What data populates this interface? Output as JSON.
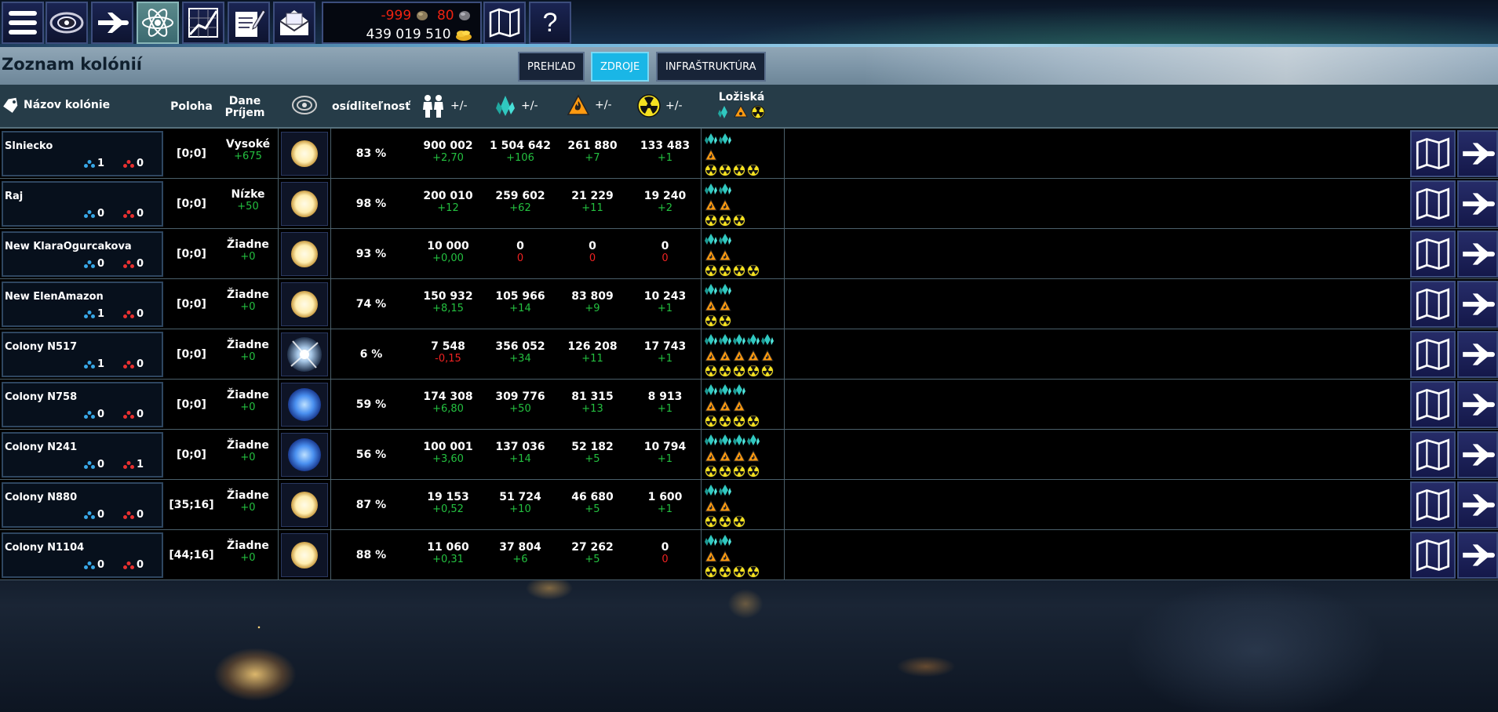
{
  "toolbar": {
    "icons": [
      "menu-icon",
      "galaxy-icon",
      "fleet-icon",
      "research-icon",
      "stats-icon",
      "notes-icon",
      "mail-icon",
      "map-icon",
      "help-icon"
    ],
    "help_label": "?"
  },
  "resources": {
    "stone": "-999",
    "ore": "80",
    "gold": "439 019 510"
  },
  "page": {
    "title": "Zoznam kolónií"
  },
  "tabs": [
    {
      "label": "PREHĽAD",
      "active": false
    },
    {
      "label": "ZDROJE",
      "active": true
    },
    {
      "label": "INFRAŠTRUKTÚRA",
      "active": false
    }
  ],
  "header": {
    "name": "Názov kolónie",
    "position": "Poloha",
    "tax_line1": "Dane",
    "tax_line2": "Príjem",
    "habitability": "osídliteľnosť",
    "pm": "+/-",
    "deposits": "Ložiská"
  },
  "colonies": [
    {
      "name": "Slniecko",
      "blue": "1",
      "red": "0",
      "pos": "[0;0]",
      "tax": "Vysoké",
      "income": "+675",
      "star": "yellow",
      "hab": "83 %",
      "pop": "900 002",
      "pop_d": "+2,70",
      "pop_neg": false,
      "cry": "1 504 642",
      "cry_d": "+106",
      "cry_neg": false,
      "fuel": "261 880",
      "fuel_d": "+7",
      "fuel_neg": false,
      "rad": "133 483",
      "rad_d": "+1",
      "rad_neg": false,
      "dep": [
        2,
        1,
        4
      ]
    },
    {
      "name": "Raj",
      "blue": "0",
      "red": "0",
      "pos": "[0;0]",
      "tax": "Nízke",
      "income": "+50",
      "star": "yellow",
      "hab": "98 %",
      "pop": "200 010",
      "pop_d": "+12",
      "pop_neg": false,
      "cry": "259 602",
      "cry_d": "+62",
      "cry_neg": false,
      "fuel": "21 229",
      "fuel_d": "+11",
      "fuel_neg": false,
      "rad": "19 240",
      "rad_d": "+2",
      "rad_neg": false,
      "dep": [
        2,
        2,
        3
      ]
    },
    {
      "name": "New KlaraOgurcakova",
      "blue": "0",
      "red": "0",
      "pos": "[0;0]",
      "tax": "Žiadne",
      "income": "+0",
      "star": "yellow",
      "hab": "93 %",
      "pop": "10 000",
      "pop_d": "+0,00",
      "pop_neg": false,
      "cry": "0",
      "cry_d": "0",
      "cry_neg": true,
      "fuel": "0",
      "fuel_d": "0",
      "fuel_neg": true,
      "rad": "0",
      "rad_d": "0",
      "rad_neg": true,
      "dep": [
        2,
        2,
        4
      ]
    },
    {
      "name": "New ElenAmazon",
      "blue": "1",
      "red": "0",
      "pos": "[0;0]",
      "tax": "Žiadne",
      "income": "+0",
      "star": "yellow",
      "hab": "74 %",
      "pop": "150 932",
      "pop_d": "+8,15",
      "pop_neg": false,
      "cry": "105 966",
      "cry_d": "+14",
      "cry_neg": false,
      "fuel": "83 809",
      "fuel_d": "+9",
      "fuel_neg": false,
      "rad": "10 243",
      "rad_d": "+1",
      "rad_neg": false,
      "dep": [
        2,
        2,
        2
      ]
    },
    {
      "name": "Colony N517",
      "blue": "1",
      "red": "0",
      "pos": "[0;0]",
      "tax": "Žiadne",
      "income": "+0",
      "star": "pulsar",
      "hab": "6 %",
      "pop": "7 548",
      "pop_d": "-0,15",
      "pop_neg": true,
      "cry": "356 052",
      "cry_d": "+34",
      "cry_neg": false,
      "fuel": "126 208",
      "fuel_d": "+11",
      "fuel_neg": false,
      "rad": "17 743",
      "rad_d": "+1",
      "rad_neg": false,
      "dep": [
        5,
        5,
        5
      ]
    },
    {
      "name": "Colony N758",
      "blue": "0",
      "red": "0",
      "pos": "[0;0]",
      "tax": "Žiadne",
      "income": "+0",
      "star": "blue",
      "hab": "59 %",
      "pop": "174 308",
      "pop_d": "+6,80",
      "pop_neg": false,
      "cry": "309 776",
      "cry_d": "+50",
      "cry_neg": false,
      "fuel": "81 315",
      "fuel_d": "+13",
      "fuel_neg": false,
      "rad": "8 913",
      "rad_d": "+1",
      "rad_neg": false,
      "dep": [
        3,
        3,
        4
      ]
    },
    {
      "name": "Colony N241",
      "blue": "0",
      "red": "1",
      "pos": "[0;0]",
      "tax": "Žiadne",
      "income": "+0",
      "star": "blue",
      "hab": "56 %",
      "pop": "100 001",
      "pop_d": "+3,60",
      "pop_neg": false,
      "cry": "137 036",
      "cry_d": "+14",
      "cry_neg": false,
      "fuel": "52 182",
      "fuel_d": "+5",
      "fuel_neg": false,
      "rad": "10 794",
      "rad_d": "+1",
      "rad_neg": false,
      "dep": [
        4,
        4,
        4
      ]
    },
    {
      "name": "Colony N880",
      "blue": "0",
      "red": "0",
      "pos": "[35;16]",
      "tax": "Žiadne",
      "income": "+0",
      "star": "yellow",
      "hab": "87 %",
      "pop": "19 153",
      "pop_d": "+0,52",
      "pop_neg": false,
      "cry": "51 724",
      "cry_d": "+10",
      "cry_neg": false,
      "fuel": "46 680",
      "fuel_d": "+5",
      "fuel_neg": false,
      "rad": "1 600",
      "rad_d": "+1",
      "rad_neg": false,
      "dep": [
        2,
        2,
        3
      ]
    },
    {
      "name": "Colony N1104",
      "blue": "0",
      "red": "0",
      "pos": "[44;16]",
      "tax": "Žiadne",
      "income": "+0",
      "star": "yellow",
      "hab": "88 %",
      "pop": "11 060",
      "pop_d": "+0,31",
      "pop_neg": false,
      "cry": "37 804",
      "cry_d": "+6",
      "cry_neg": false,
      "fuel": "27 262",
      "fuel_d": "+5",
      "fuel_neg": false,
      "rad": "0",
      "rad_d": "0",
      "rad_neg": true,
      "dep": [
        2,
        2,
        4
      ]
    }
  ],
  "row_actions": [
    "map-icon",
    "fleet-icon"
  ],
  "colors": {
    "positive": "#24c040",
    "negative": "#ee2222",
    "active_tab": "#1ab6e6",
    "crystal": "#30c8c0",
    "fuel": "#ff9a10",
    "radiation": "#f4e020"
  }
}
